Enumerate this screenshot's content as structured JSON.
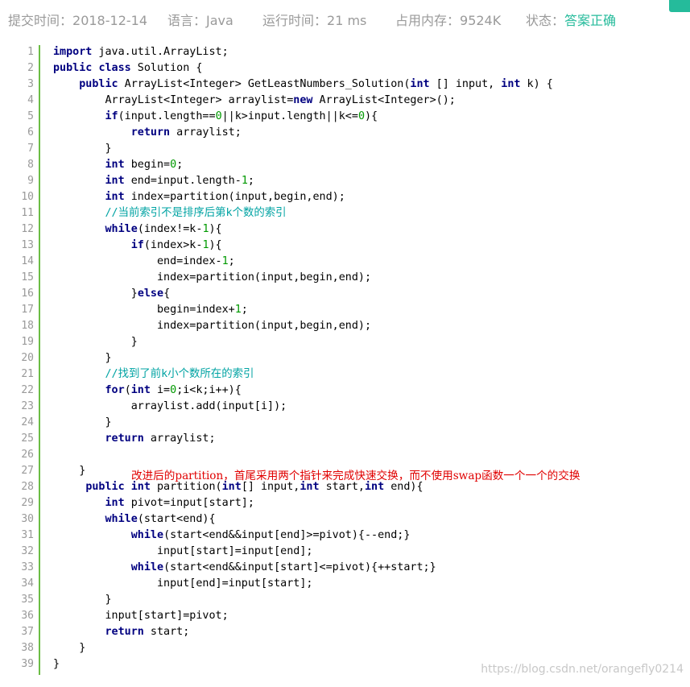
{
  "submission": {
    "submit_time_label": "提交时间：",
    "submit_time": "2018-12-14",
    "language_label": "语言：",
    "language": "Java",
    "run_time_label": "运行时间：",
    "run_time": "21 ms",
    "memory_label": "占用内存：",
    "memory": "9524K",
    "status_label": "状态：",
    "status": "答案正确"
  },
  "colors": {
    "accent": "#25bb9b",
    "gutter": "#6cbd45",
    "keyword": "#000080",
    "number": "#009900",
    "comment": "#00a3a3",
    "annotation": "#e00000"
  },
  "code": {
    "lines": [
      {
        "n": "1",
        "tokens": [
          {
            "t": "import",
            "c": "kw"
          },
          {
            "t": " java.util.ArrayList;"
          }
        ]
      },
      {
        "n": "2",
        "tokens": [
          {
            "t": "public",
            "c": "kw"
          },
          {
            "t": " "
          },
          {
            "t": "class",
            "c": "kw"
          },
          {
            "t": " Solution {"
          }
        ]
      },
      {
        "n": "3",
        "tokens": [
          {
            "t": "    "
          },
          {
            "t": "public",
            "c": "kw"
          },
          {
            "t": " ArrayList<Integer> GetLeastNumbers_Solution("
          },
          {
            "t": "int",
            "c": "kw"
          },
          {
            "t": " [] input, "
          },
          {
            "t": "int",
            "c": "kw"
          },
          {
            "t": " k) {"
          }
        ]
      },
      {
        "n": "4",
        "tokens": [
          {
            "t": "        ArrayList<Integer> arraylist="
          },
          {
            "t": "new",
            "c": "kw"
          },
          {
            "t": " ArrayList<Integer>();"
          }
        ]
      },
      {
        "n": "5",
        "tokens": [
          {
            "t": "        "
          },
          {
            "t": "if",
            "c": "kw"
          },
          {
            "t": "(input.length=="
          },
          {
            "t": "0",
            "c": "num"
          },
          {
            "t": "||k>input.length||k<="
          },
          {
            "t": "0",
            "c": "num"
          },
          {
            "t": "){"
          }
        ]
      },
      {
        "n": "6",
        "tokens": [
          {
            "t": "            "
          },
          {
            "t": "return",
            "c": "kw"
          },
          {
            "t": " arraylist;"
          }
        ]
      },
      {
        "n": "7",
        "tokens": [
          {
            "t": "        }"
          }
        ]
      },
      {
        "n": "8",
        "tokens": [
          {
            "t": "        "
          },
          {
            "t": "int",
            "c": "kw"
          },
          {
            "t": " begin="
          },
          {
            "t": "0",
            "c": "num"
          },
          {
            "t": ";"
          }
        ]
      },
      {
        "n": "9",
        "tokens": [
          {
            "t": "        "
          },
          {
            "t": "int",
            "c": "kw"
          },
          {
            "t": " end=input.length-"
          },
          {
            "t": "1",
            "c": "num"
          },
          {
            "t": ";"
          }
        ]
      },
      {
        "n": "10",
        "tokens": [
          {
            "t": "        "
          },
          {
            "t": "int",
            "c": "kw"
          },
          {
            "t": " index=partition(input,begin,end);"
          }
        ]
      },
      {
        "n": "11",
        "tokens": [
          {
            "t": "        "
          },
          {
            "t": "//当前索引不是排序后第k个数的索引",
            "c": "cm"
          }
        ]
      },
      {
        "n": "12",
        "tokens": [
          {
            "t": "        "
          },
          {
            "t": "while",
            "c": "kw"
          },
          {
            "t": "(index!=k-"
          },
          {
            "t": "1",
            "c": "num"
          },
          {
            "t": "){"
          }
        ]
      },
      {
        "n": "13",
        "tokens": [
          {
            "t": "            "
          },
          {
            "t": "if",
            "c": "kw"
          },
          {
            "t": "(index>k-"
          },
          {
            "t": "1",
            "c": "num"
          },
          {
            "t": "){"
          }
        ]
      },
      {
        "n": "14",
        "tokens": [
          {
            "t": "                end=index-"
          },
          {
            "t": "1",
            "c": "num"
          },
          {
            "t": ";"
          }
        ]
      },
      {
        "n": "15",
        "tokens": [
          {
            "t": "                index=partition(input,begin,end);"
          }
        ]
      },
      {
        "n": "16",
        "tokens": [
          {
            "t": "            }"
          },
          {
            "t": "else",
            "c": "kw"
          },
          {
            "t": "{"
          }
        ]
      },
      {
        "n": "17",
        "tokens": [
          {
            "t": "                begin=index+"
          },
          {
            "t": "1",
            "c": "num"
          },
          {
            "t": ";"
          }
        ]
      },
      {
        "n": "18",
        "tokens": [
          {
            "t": "                index=partition(input,begin,end);"
          }
        ]
      },
      {
        "n": "19",
        "tokens": [
          {
            "t": "            }"
          }
        ]
      },
      {
        "n": "20",
        "tokens": [
          {
            "t": "        }"
          }
        ]
      },
      {
        "n": "21",
        "tokens": [
          {
            "t": "        "
          },
          {
            "t": "//找到了前k小个数所在的索引",
            "c": "cm"
          }
        ]
      },
      {
        "n": "22",
        "tokens": [
          {
            "t": "        "
          },
          {
            "t": "for",
            "c": "kw"
          },
          {
            "t": "("
          },
          {
            "t": "int",
            "c": "kw"
          },
          {
            "t": " i="
          },
          {
            "t": "0",
            "c": "num"
          },
          {
            "t": ";i<k;i++){"
          }
        ]
      },
      {
        "n": "23",
        "tokens": [
          {
            "t": "            arraylist.add(input[i]);"
          }
        ]
      },
      {
        "n": "24",
        "tokens": [
          {
            "t": "        }"
          }
        ]
      },
      {
        "n": "25",
        "tokens": [
          {
            "t": "        "
          },
          {
            "t": "return",
            "c": "kw"
          },
          {
            "t": " arraylist;"
          }
        ]
      },
      {
        "n": "26",
        "tokens": [
          {
            "t": ""
          }
        ]
      },
      {
        "n": "27",
        "tokens": [
          {
            "t": "    }"
          }
        ]
      },
      {
        "n": "28",
        "tokens": [
          {
            "t": "     "
          },
          {
            "t": "public",
            "c": "kw"
          },
          {
            "t": " "
          },
          {
            "t": "int",
            "c": "kw"
          },
          {
            "t": " partition("
          },
          {
            "t": "int",
            "c": "kw"
          },
          {
            "t": "[] input,"
          },
          {
            "t": "int",
            "c": "kw"
          },
          {
            "t": " start,"
          },
          {
            "t": "int",
            "c": "kw"
          },
          {
            "t": " end){"
          }
        ]
      },
      {
        "n": "29",
        "tokens": [
          {
            "t": "        "
          },
          {
            "t": "int",
            "c": "kw"
          },
          {
            "t": " pivot=input[start];"
          }
        ]
      },
      {
        "n": "30",
        "tokens": [
          {
            "t": "        "
          },
          {
            "t": "while",
            "c": "kw"
          },
          {
            "t": "(start<end){"
          }
        ]
      },
      {
        "n": "31",
        "tokens": [
          {
            "t": "            "
          },
          {
            "t": "while",
            "c": "kw"
          },
          {
            "t": "(start<end&&input[end]>=pivot){--end;}"
          }
        ]
      },
      {
        "n": "32",
        "tokens": [
          {
            "t": "                input[start]=input[end];"
          }
        ]
      },
      {
        "n": "33",
        "tokens": [
          {
            "t": "            "
          },
          {
            "t": "while",
            "c": "kw"
          },
          {
            "t": "(start<end&&input[start]<=pivot){++start;}"
          }
        ]
      },
      {
        "n": "34",
        "tokens": [
          {
            "t": "                input[end]=input[start];"
          }
        ]
      },
      {
        "n": "35",
        "tokens": [
          {
            "t": "        }"
          }
        ]
      },
      {
        "n": "36",
        "tokens": [
          {
            "t": "        input[start]=pivot;"
          }
        ]
      },
      {
        "n": "37",
        "tokens": [
          {
            "t": "        "
          },
          {
            "t": "return",
            "c": "kw"
          },
          {
            "t": " start;"
          }
        ]
      },
      {
        "n": "38",
        "tokens": [
          {
            "t": "    }"
          }
        ]
      },
      {
        "n": "39",
        "tokens": [
          {
            "t": "}"
          }
        ]
      }
    ]
  },
  "annotation": {
    "text": "改进后的partition，首尾采用两个指针来完成快速交换，而不使用swap函数一个一个的交换"
  },
  "watermark": {
    "text": "https://blog.csdn.net/orangefly0214"
  }
}
